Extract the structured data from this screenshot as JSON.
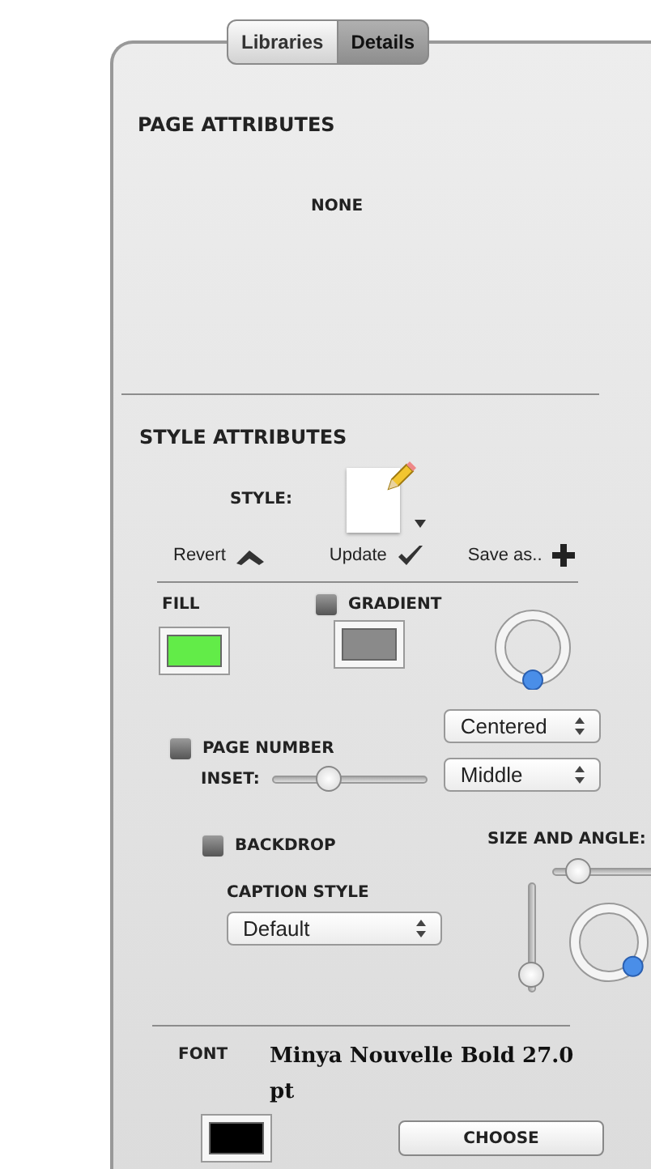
{
  "tabs": [
    {
      "label": "Libraries",
      "selected": false
    },
    {
      "label": "Details",
      "selected": true
    }
  ],
  "page_attributes": {
    "title": "PAGE ATTRIBUTES",
    "value": "NONE"
  },
  "style_attributes": {
    "title": "STYLE ATTRIBUTES",
    "style_label": "STYLE:",
    "actions": [
      {
        "label": "Revert",
        "kind": "revert"
      },
      {
        "label": "Update",
        "kind": "update"
      },
      {
        "label": "Save as..",
        "kind": "save"
      }
    ]
  },
  "fill": {
    "label": "FILL",
    "swatches": [
      {
        "color": "#62ec48"
      },
      {
        "color": "#8a8a8a"
      }
    ],
    "gradient": {
      "label": "GRADIENT",
      "checked": false
    }
  },
  "page_number": {
    "label": "PAGE NUMBER",
    "checked": false,
    "inset_label": "INSET:",
    "inset": {
      "level": 0.36
    },
    "position": "Centered",
    "alignment": "Middle"
  },
  "backdrop": {
    "label": "BACKDROP",
    "checked": false
  },
  "size_and_angle": {
    "label": "SIZE AND ANGLE:",
    "size_slider": {
      "level": 0.22
    },
    "vertical_slider": {
      "level": 0.15
    }
  },
  "caption_style": {
    "label": "CAPTION STYLE",
    "value": "Default"
  },
  "font": {
    "label": "FONT",
    "name": "Minya Nouvelle Bold 27.0 pt",
    "color": "#000000",
    "button": "CHOOSE"
  }
}
